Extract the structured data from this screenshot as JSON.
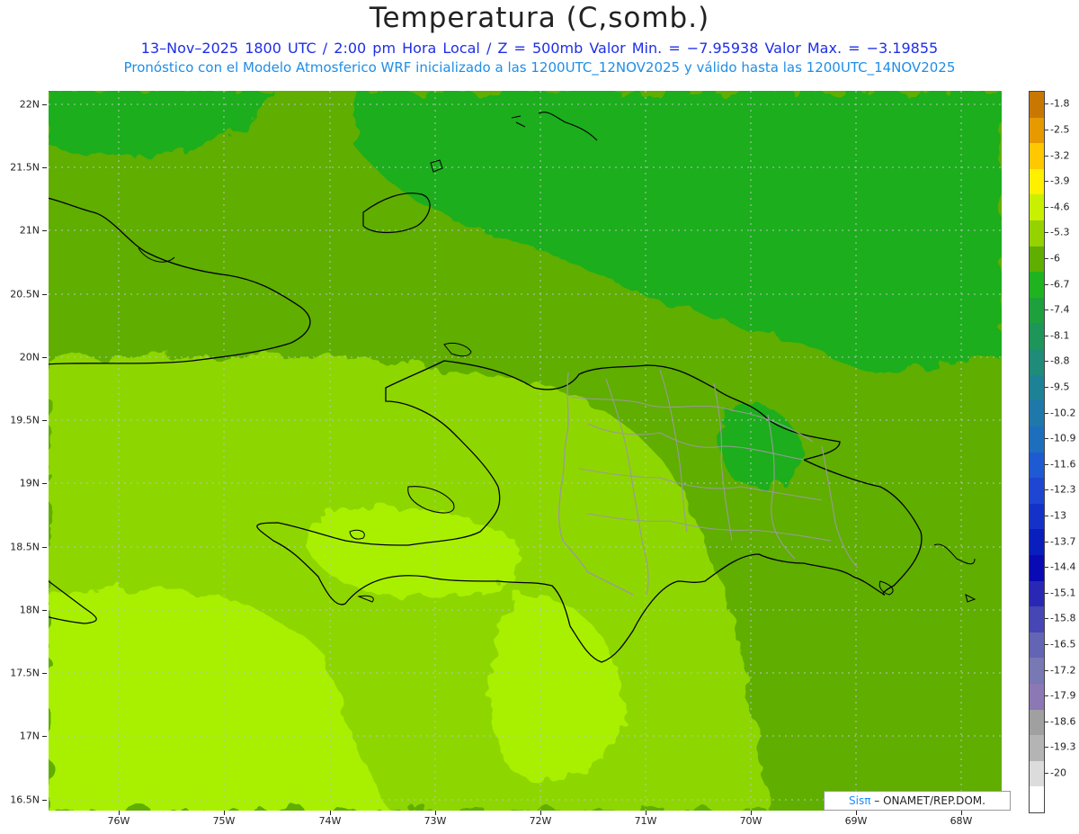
{
  "title": "Temperatura (C,somb.)",
  "subtitle1": "13–Nov–2025  1800 UTC / 2:00 pm Hora Local / Z = 500mb  Valor Min. = −7.95938  Valor Max. = −3.19855",
  "subtitle2": "Pronóstico con el Modelo Atmosferico WRF inicializado a las 1200UTC_12NOV2025 y válido hasta las  1200UTC_14NOV2025",
  "credit": {
    "brand": "Sisπ",
    "text": "– ONAMET/REP.DOM."
  },
  "colors": {
    "bg_field": "#5fae00",
    "cool_field": "#1fae1f",
    "warm_field": "#8ed600",
    "warmer_field": "#a8f000",
    "coast": "#000000",
    "provinces": "#9a9a9a",
    "grid": "#9aa"
  },
  "axes": {
    "y": [
      "22N",
      "21.5N",
      "21N",
      "20.5N",
      "20N",
      "19.5N",
      "19N",
      "18.5N",
      "18N",
      "17.5N",
      "17N",
      "16.5N"
    ],
    "x": [
      "76W",
      "75W",
      "74W",
      "73W",
      "72W",
      "71W",
      "70W",
      "69W",
      "68W"
    ]
  },
  "legend": [
    {
      "label": "-1.8",
      "color": "#c87800"
    },
    {
      "label": "-2.5",
      "color": "#e69a00"
    },
    {
      "label": "-3.2",
      "color": "#ffc800"
    },
    {
      "label": "-3.9",
      "color": "#fff000"
    },
    {
      "label": "-4.6",
      "color": "#c8f000"
    },
    {
      "label": "-5.3",
      "color": "#96d200"
    },
    {
      "label": "-6",
      "color": "#5fae00"
    },
    {
      "label": "-6.7",
      "color": "#1fb41f"
    },
    {
      "label": "-7.4",
      "color": "#1ea03c"
    },
    {
      "label": "-8.1",
      "color": "#1e965a"
    },
    {
      "label": "-8.8",
      "color": "#1e8c78"
    },
    {
      "label": "-9.5",
      "color": "#1e8296"
    },
    {
      "label": "-10.2",
      "color": "#1e78aa"
    },
    {
      "label": "-10.9",
      "color": "#1e6ebe"
    },
    {
      "label": "-11.6",
      "color": "#1e5ad2"
    },
    {
      "label": "-12.3",
      "color": "#1e46d2"
    },
    {
      "label": "-13",
      "color": "#1432c8"
    },
    {
      "label": "-13.7",
      "color": "#0a1ebe"
    },
    {
      "label": "-14.4",
      "color": "#0a0ab4"
    },
    {
      "label": "-15.1",
      "color": "#2828b4"
    },
    {
      "label": "-15.8",
      "color": "#4646b4"
    },
    {
      "label": "-16.5",
      "color": "#6464b4"
    },
    {
      "label": "-17.2",
      "color": "#7878b4"
    },
    {
      "label": "-17.9",
      "color": "#8c78b4"
    },
    {
      "label": "-18.6",
      "color": "#a0a0a0"
    },
    {
      "label": "-19.3",
      "color": "#b4b4b4"
    },
    {
      "label": "-20",
      "color": "#dcdcdc"
    },
    {
      "label": "",
      "color": "#ffffff"
    }
  ]
}
